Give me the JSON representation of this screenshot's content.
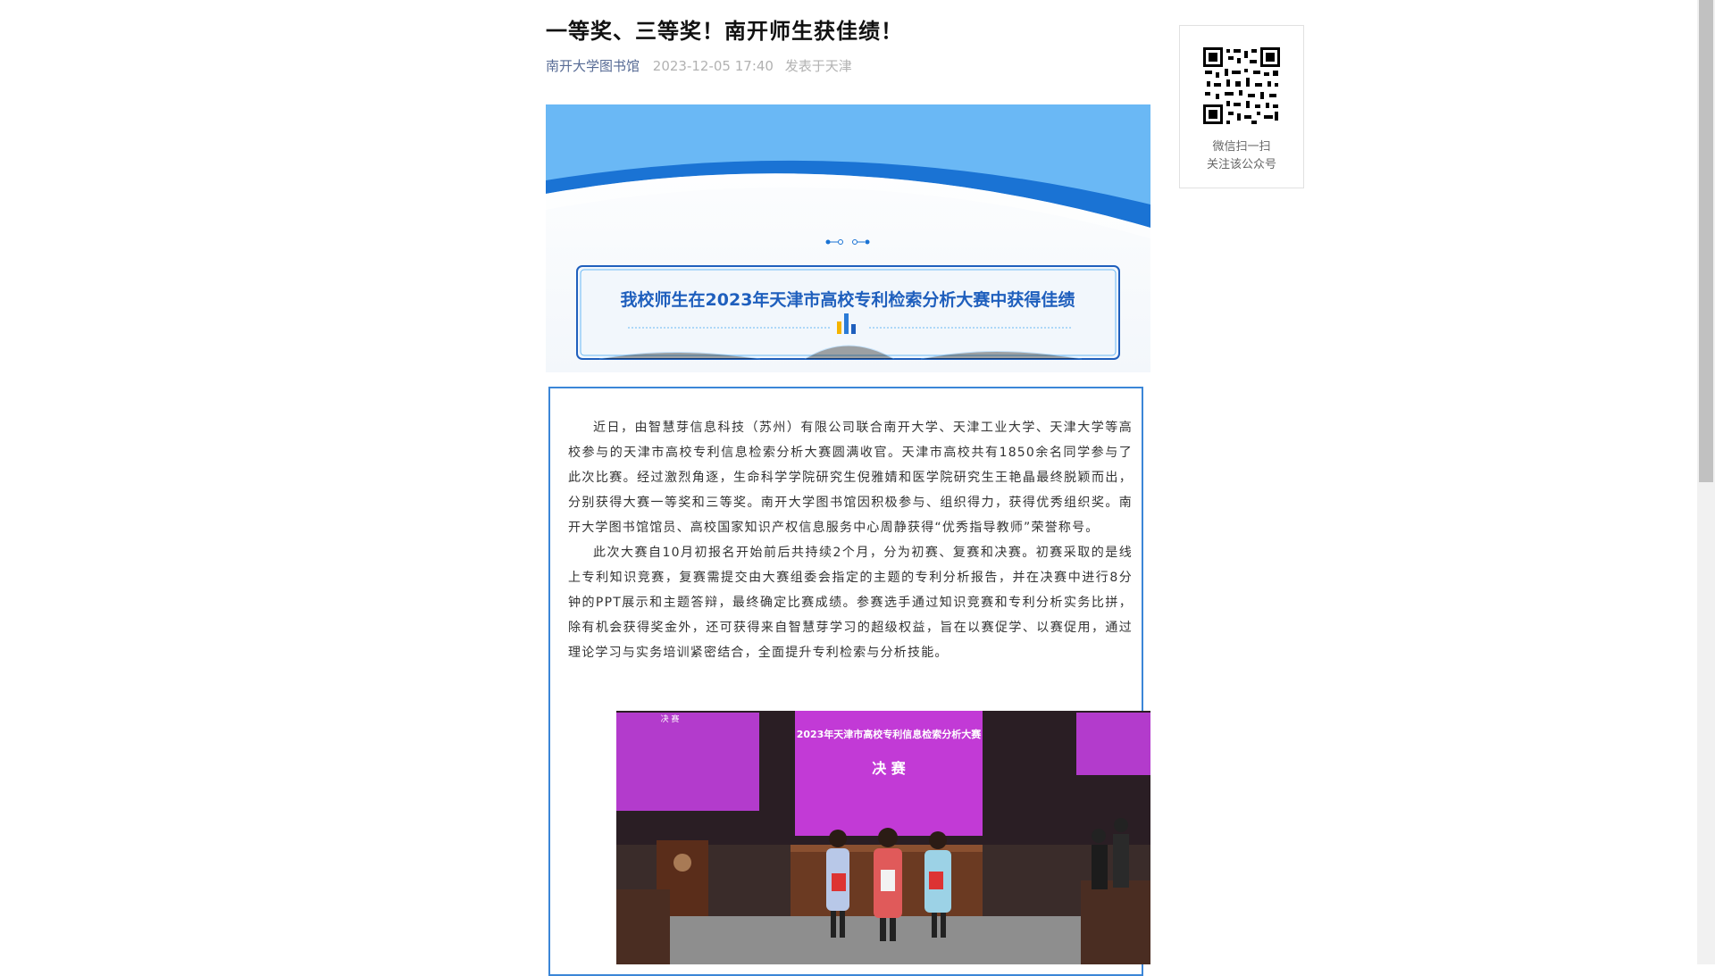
{
  "article": {
    "title": "一等奖、三等奖！南开师生获佳绩！",
    "source": "南开大学图书馆",
    "datetime": "2023-12-05 17:40",
    "location": "发表于天津",
    "banner_heading": "我校师生在2023年天津市高校专利检索分析大赛中获得佳绩",
    "paragraphs": [
      "近日，由智慧芽信息科技（苏州）有限公司联合南开大学、天津工业大学、天津大学等高校参与的天津市高校专利信息检索分析大赛圆满收官。天津市高校共有1850余名同学参与了此次比赛。经过激烈角逐，生命科学学院研究生倪雅婧和医学院研究生王艳晶最终脱颖而出，分别获得大赛一等奖和三等奖。南开大学图书馆因积极参与、组织得力，获得优秀组织奖。南开大学图书馆馆员、高校国家知识产权信息服务中心周静获得“优秀指导教师”荣誉称号。",
      "此次大赛自10月初报名开始前后共持续2个月，分为初赛、复赛和决赛。初赛采取的是线上专利知识竞赛，复赛需提交由大赛组委会指定的主题的专利分析报告，并在决赛中进行8分钟的PPT展示和主题答辩，最终确定比赛成绩。参赛选手通过知识竞赛和专利分析实务比拼，除有机会获得奖金外，还可获得来自智慧芽学习的超级权益，旨在以赛促学、以赛促用，通过理论学习与实务培训紧密结合，全面提升专利检索与分析技能。"
    ],
    "photo": {
      "screen_title": "2023年天津市高校专利信息检索分析大赛",
      "screen_subtitle": "决 赛",
      "side_label": "决 赛"
    }
  },
  "qr_card": {
    "line1": "微信扫一扫",
    "line2": "关注该公众号"
  },
  "colors": {
    "banner_light": "#6ab8f5",
    "banner_dark": "#1a73d4",
    "heading_blue": "#1f5fbd",
    "link": "#576b95",
    "stage_magenta": "#c23ad6"
  }
}
